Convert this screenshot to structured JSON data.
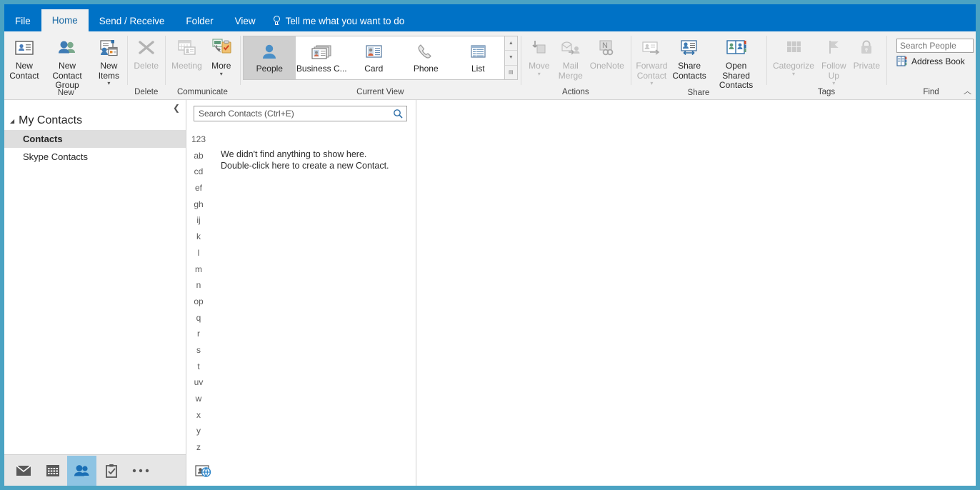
{
  "window": {
    "accent": "#0072c6",
    "border": "#4ba3c3"
  },
  "tabs": [
    {
      "label": "File",
      "active": false
    },
    {
      "label": "Home",
      "active": true
    },
    {
      "label": "Send / Receive",
      "active": false
    },
    {
      "label": "Folder",
      "active": false
    },
    {
      "label": "View",
      "active": false
    }
  ],
  "tellme": {
    "label": "Tell me what you want to do",
    "icon": "lightbulb-icon"
  },
  "ribbon": {
    "collapse_icon": "chevron-up-icon",
    "groups": [
      {
        "name": "New",
        "label": "New",
        "buttons": [
          {
            "label": "New\nContact",
            "icon": "new-contact-icon",
            "disabled": false,
            "dropdown": false
          },
          {
            "label": "New Contact\nGroup",
            "icon": "new-contact-group-icon",
            "disabled": false,
            "dropdown": false
          },
          {
            "label": "New\nItems",
            "icon": "new-items-icon",
            "disabled": false,
            "dropdown": true
          }
        ]
      },
      {
        "name": "Delete",
        "label": "Delete",
        "buttons": [
          {
            "label": "Delete",
            "icon": "delete-x-icon",
            "disabled": true,
            "dropdown": false
          }
        ]
      },
      {
        "name": "Communicate",
        "label": "Communicate",
        "buttons": [
          {
            "label": "Meeting",
            "icon": "meeting-icon",
            "disabled": true,
            "dropdown": false
          },
          {
            "label": "More",
            "icon": "more-communicate-icon",
            "disabled": false,
            "dropdown": true
          }
        ]
      },
      {
        "name": "CurrentView",
        "label": "Current View",
        "gallery": [
          {
            "label": "People",
            "icon": "people-view-icon",
            "selected": true
          },
          {
            "label": "Business C...",
            "icon": "business-card-view-icon",
            "selected": false
          },
          {
            "label": "Card",
            "icon": "card-view-icon",
            "selected": false
          },
          {
            "label": "Phone",
            "icon": "phone-view-icon",
            "selected": false
          },
          {
            "label": "List",
            "icon": "list-view-icon",
            "selected": false
          }
        ],
        "scroll": [
          {
            "icon": "scroll-up-icon"
          },
          {
            "icon": "scroll-down-icon"
          },
          {
            "icon": "gallery-more-icon"
          }
        ]
      },
      {
        "name": "Actions",
        "label": "Actions",
        "buttons": [
          {
            "label": "Move",
            "icon": "move-folder-icon",
            "disabled": true,
            "dropdown": true
          },
          {
            "label": "Mail\nMerge",
            "icon": "mail-merge-icon",
            "disabled": true,
            "dropdown": false
          },
          {
            "label": "OneNote",
            "icon": "onenote-icon",
            "disabled": true,
            "dropdown": false
          }
        ]
      },
      {
        "name": "Share",
        "label": "Share",
        "buttons": [
          {
            "label": "Forward\nContact",
            "icon": "forward-contact-icon",
            "disabled": true,
            "dropdown": true
          },
          {
            "label": "Share\nContacts",
            "icon": "share-contacts-icon",
            "disabled": false,
            "dropdown": false
          },
          {
            "label": "Open Shared\nContacts",
            "icon": "open-shared-contacts-icon",
            "disabled": false,
            "dropdown": false
          }
        ]
      },
      {
        "name": "Tags",
        "label": "Tags",
        "buttons": [
          {
            "label": "Categorize",
            "icon": "categorize-icon",
            "disabled": true,
            "dropdown": true
          },
          {
            "label": "Follow\nUp",
            "icon": "follow-up-flag-icon",
            "disabled": true,
            "dropdown": true
          },
          {
            "label": "Private",
            "icon": "private-lock-icon",
            "disabled": true,
            "dropdown": false
          }
        ]
      },
      {
        "name": "Find",
        "label": "Find",
        "search_people_placeholder": "Search People",
        "address_book_label": "Address Book",
        "address_book_icon": "address-book-icon"
      }
    ]
  },
  "sidebar": {
    "collapse_icon": "chevron-left-icon",
    "header": "My Contacts",
    "header_triangle": "triangle-down-icon",
    "items": [
      {
        "label": "Contacts",
        "selected": true
      },
      {
        "label": "Skype Contacts",
        "selected": false
      }
    ],
    "nav": [
      {
        "icon": "mail-icon",
        "selected": false
      },
      {
        "icon": "calendar-icon",
        "selected": false
      },
      {
        "icon": "people-icon",
        "selected": true
      },
      {
        "icon": "tasks-icon",
        "selected": false
      },
      {
        "icon": "more-ellipsis-icon",
        "selected": false
      }
    ]
  },
  "list_pane": {
    "search_placeholder": "Search Contacts (Ctrl+E)",
    "search_icon": "search-icon",
    "alpha_index": [
      "123",
      "ab",
      "cd",
      "ef",
      "gh",
      "ij",
      "k",
      "l",
      "m",
      "n",
      "op",
      "q",
      "r",
      "s",
      "t",
      "uv",
      "w",
      "x",
      "y",
      "z"
    ],
    "empty_line1": "We didn't find anything to show here.",
    "empty_line2": "Double-click here to create a new Contact.",
    "footer_icon": "contact-globe-icon"
  }
}
